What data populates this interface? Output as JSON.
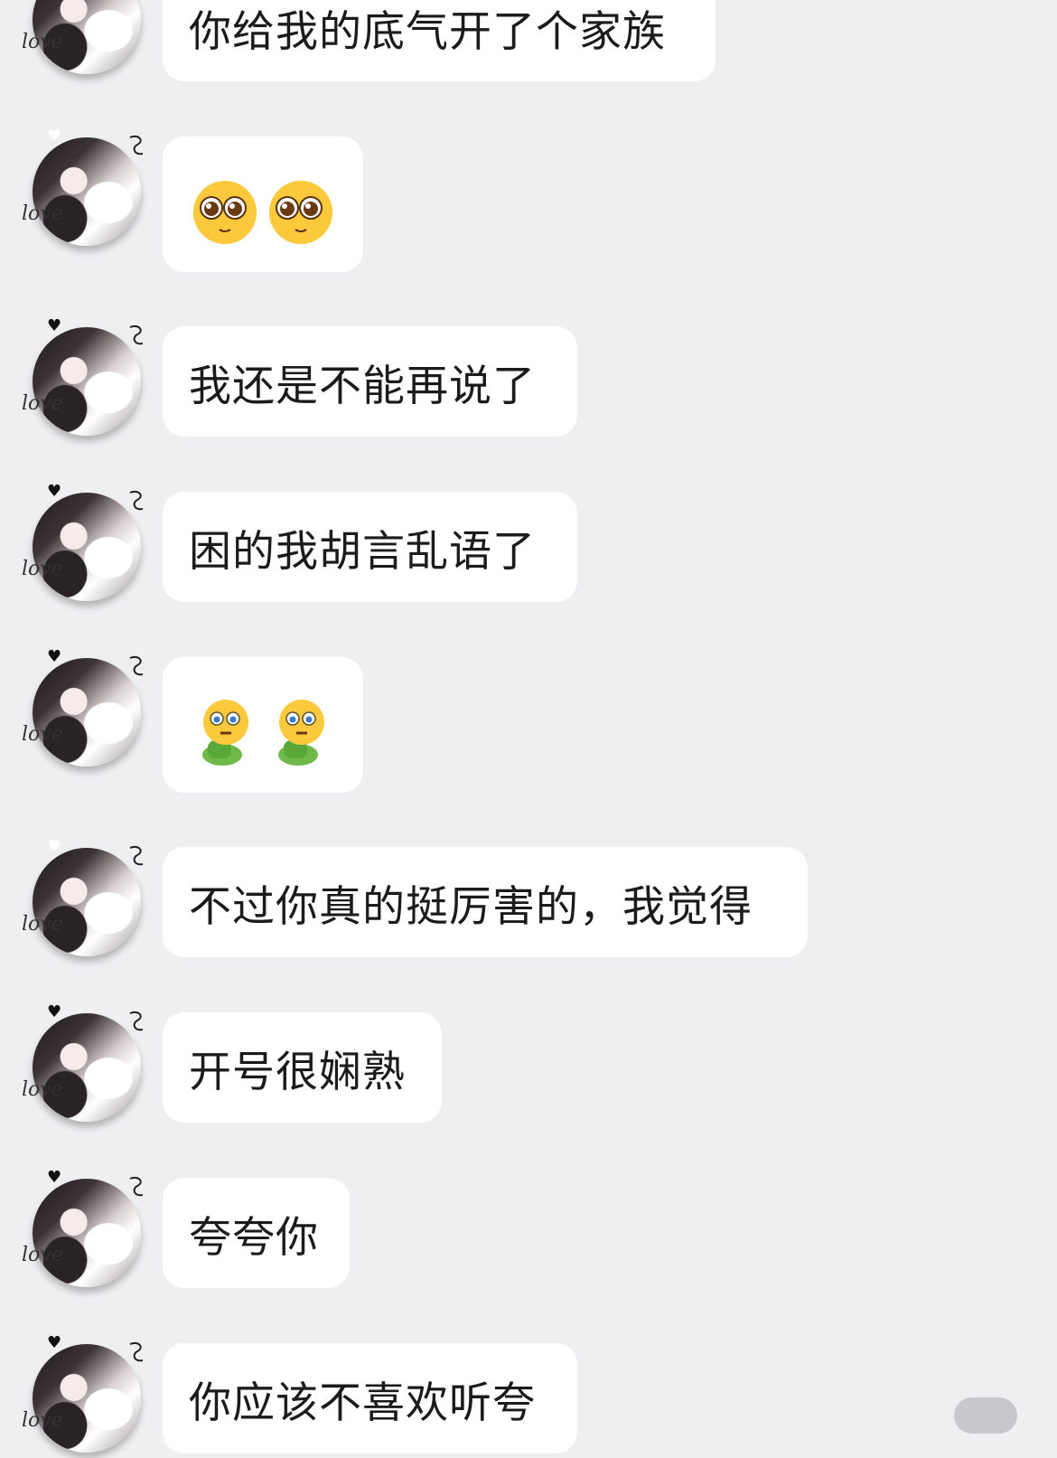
{
  "avatar": {
    "heart_glyph": "♥",
    "love_text": "love"
  },
  "messages": [
    {
      "type": "text",
      "text": "你给我的底气开了个家族"
    },
    {
      "type": "emoji",
      "icon": "pleading-face-emoji",
      "count": 2
    },
    {
      "type": "text",
      "text": "我还是不能再说了"
    },
    {
      "type": "text",
      "text": "困的我胡言乱语了"
    },
    {
      "type": "emoji",
      "icon": "crying-sitting-emoji",
      "count": 2
    },
    {
      "type": "text",
      "text": "不过你真的挺厉害的，我觉得"
    },
    {
      "type": "text",
      "text": "开号很娴熟"
    },
    {
      "type": "text",
      "text": "夸夸你"
    },
    {
      "type": "text",
      "text": "你应该不喜欢听夸"
    }
  ],
  "colors": {
    "background": "#efeff2",
    "bubble": "#ffffff",
    "text": "#1b1b1b"
  }
}
